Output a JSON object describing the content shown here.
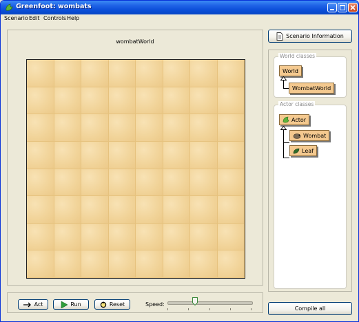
{
  "window": {
    "title": "Greenfoot: wombats"
  },
  "menu": {
    "items": [
      {
        "label": "Scenario"
      },
      {
        "label": "Edit"
      },
      {
        "label": "Controls"
      },
      {
        "label": "Help"
      }
    ]
  },
  "world": {
    "title": "wombatWorld",
    "columns": 8,
    "rows": 8
  },
  "controls": {
    "act_label": "Act",
    "run_label": "Run",
    "reset_label": "Reset",
    "speed_label": "Speed:",
    "speed_value": 0.33
  },
  "right": {
    "scenario_info_label": "Scenario Information",
    "world_classes_label": "World classes",
    "world_classes": [
      "World",
      "WombatWorld"
    ],
    "actor_classes_label": "Actor classes",
    "actor_classes": [
      "Actor",
      "Wombat",
      "Leaf"
    ],
    "compile_label": "Compile all"
  }
}
